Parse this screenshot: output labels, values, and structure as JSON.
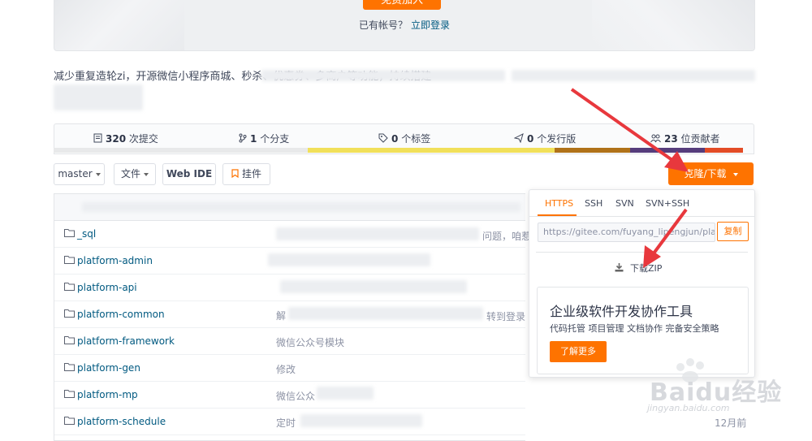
{
  "banner": {
    "join_label": "免费加入",
    "have_account": "已有帐号？",
    "login_link": "立即登录"
  },
  "description": "减少重复造轮zi，开源微信小程序商城、秒杀、优惠券、多商户等功能，持续搭建一",
  "stats": {
    "commits": {
      "count": "320",
      "label": "次提交"
    },
    "branches": {
      "count": "1",
      "label": "个分支"
    },
    "tags": {
      "count": "0",
      "label": "个标签"
    },
    "releases": {
      "count": "0",
      "label": "个发行版"
    },
    "contributors": {
      "count": "23",
      "label": "位贡献者"
    }
  },
  "lang_colors": [
    "#e8e9ea",
    "#f1e05a",
    "#b07219",
    "#563d7c",
    "#e34c26"
  ],
  "toolbar": {
    "branch": "master",
    "file": "文件",
    "web_ide": "Web IDE",
    "widget": "挂件",
    "clone": "克隆/下载"
  },
  "files": [
    {
      "name": "_sql",
      "msg": "",
      "date": ""
    },
    {
      "name": "platform-admin",
      "msg": "",
      "date": ""
    },
    {
      "name": "platform-api",
      "msg": "",
      "date": ""
    },
    {
      "name": "platform-common",
      "msg": "解",
      "date": ""
    },
    {
      "name": "platform-framework",
      "msg": "微信公众号模块",
      "date": ""
    },
    {
      "name": "platform-gen",
      "msg": "修改",
      "date": ""
    },
    {
      "name": "platform-mp",
      "msg": "微信公众",
      "date": ""
    },
    {
      "name": "platform-schedule",
      "msg": "定时",
      "date": "12月前"
    }
  ],
  "partial_texts": {
    "sql_tail": "问题，咱惹",
    "common_tail": "转到登录"
  },
  "dropdown": {
    "tabs": [
      "HTTPS",
      "SSH",
      "SVN",
      "SVN+SSH"
    ],
    "url": "https://gitee.com/fuyang_lipengjun/pla",
    "copy": "复制",
    "download_zip": "下载ZIP",
    "ent_title": "企业级软件开发协作工具",
    "ent_sub": "代码托管 项目管理 文档协作 完备安全策略",
    "ent_button": "了解更多"
  },
  "watermark": {
    "text": "Baidu经验",
    "url": "jingyan.baidu.com"
  },
  "accent_color": "#fe7300"
}
